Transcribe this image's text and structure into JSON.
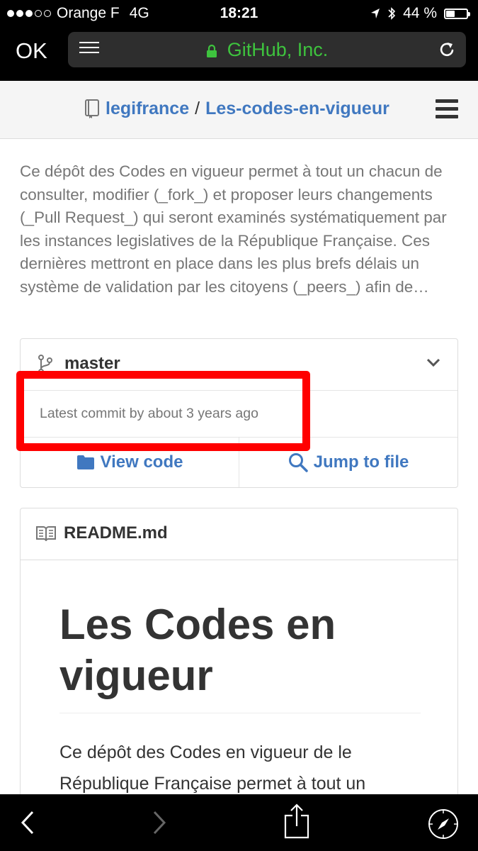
{
  "status_bar": {
    "carrier": "Orange F",
    "network": "4G",
    "time": "18:21",
    "battery": "44 %",
    "battery_level": 0.44
  },
  "browser": {
    "done_label": "OK",
    "url_text": "GitHub, Inc.",
    "url_color": "#3ec33e"
  },
  "repo": {
    "owner": "legifrance",
    "separator": "/",
    "name": "Les-codes-en-vigueur",
    "description": "Ce dépôt des Codes en vigueur permet à tout un chacun de consulter, modifier (_fork_) et proposer leurs changements (_Pull Request_) qui seront examinés systématiquement par les instances legislatives de la République Française. Ces dernières mettront en place dans les plus brefs délais un système de validation par les citoyens (_peers_) afin de…"
  },
  "branch": {
    "name": "master",
    "latest_commit": "Latest commit by about 3 years ago",
    "view_code_label": "View code",
    "jump_to_file_label": "Jump to file"
  },
  "readme": {
    "file_name": "README.md",
    "heading": "Les Codes en vigueur",
    "paragraph": "Ce dépôt des Codes en vigueur de le République Française permet à tout un"
  },
  "colors": {
    "link": "#4078c0",
    "highlight": "#ff0000"
  },
  "icons": {
    "signal": "signal-dots-icon",
    "location": "location-arrow-icon",
    "bluetooth": "bluetooth-icon",
    "battery": "battery-icon",
    "reader": "reader-view-icon",
    "lock": "lock-icon",
    "reload": "reload-icon",
    "repo": "repo-book-icon",
    "menu": "hamburger-menu-icon",
    "branch": "git-branch-icon",
    "chevron": "chevron-down-icon",
    "folder": "folder-icon",
    "search": "search-icon",
    "book": "book-open-icon",
    "back": "back-arrow-icon",
    "forward": "forward-arrow-icon",
    "share": "share-icon",
    "compass": "safari-compass-icon"
  }
}
